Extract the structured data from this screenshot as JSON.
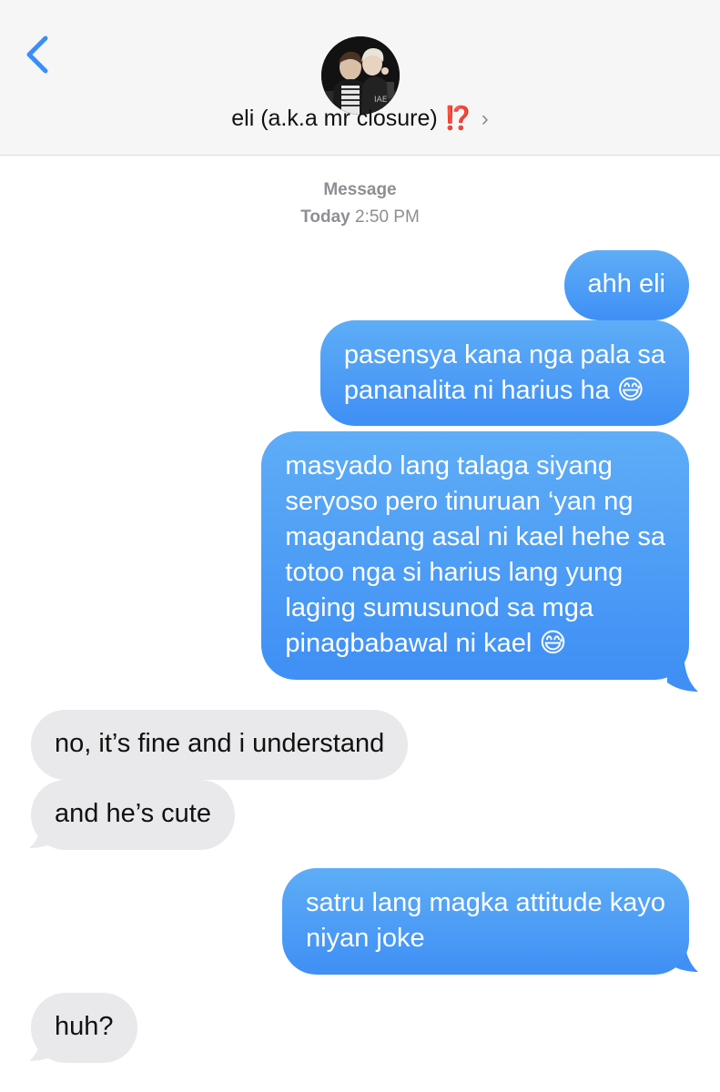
{
  "header": {
    "back_icon": "chevron-left-icon",
    "contact_name": "eli (a.k.a mr closure) ⁉️",
    "chevron": "›",
    "accent_color": "#3a8ef6"
  },
  "thread": {
    "service_label": "Message",
    "day_label": "Today",
    "time_label": "2:50 PM"
  },
  "messages": [
    {
      "from": "me",
      "text": "ahh eli"
    },
    {
      "from": "me",
      "text": "pasensya kana nga pala sa\npananalita ni harius ha 😅"
    },
    {
      "from": "me",
      "text": "masyado lang talaga siyang\nseryoso pero tinuruan ‘yan ng\nmagandang asal ni kael hehe sa\ntotoo nga si harius lang yung\nlaging sumusunod sa mga\npinagbabawal ni kael 😅"
    },
    {
      "from": "them",
      "text": "no, it’s fine and i understand"
    },
    {
      "from": "them",
      "text": "and he’s cute"
    },
    {
      "from": "me",
      "text": "satru lang magka attitude kayo\nniyan joke"
    },
    {
      "from": "them",
      "text": "huh?"
    }
  ]
}
